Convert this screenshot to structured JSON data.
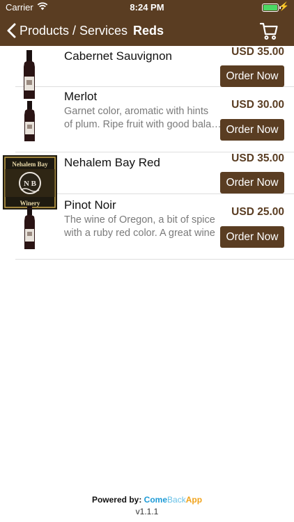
{
  "status_bar": {
    "carrier": "Carrier",
    "time": "8:24 PM"
  },
  "nav": {
    "back_label": "Products / Services",
    "title": "Reds"
  },
  "products": [
    {
      "name": "Cabernet Sauvignon",
      "desc_lines": [],
      "price": "USD 35.00",
      "order_label": "Order Now",
      "thumb": "wine-bottle"
    },
    {
      "name": "Merlot",
      "desc_lines": [
        "Garnet color, aromatic with hints",
        "of plum. Ripe fruit with good balance"
      ],
      "price": "USD 30.00",
      "order_label": "Order Now",
      "thumb": "wine-bottle"
    },
    {
      "name": "Nehalem Bay Red",
      "desc_lines": [],
      "price": "USD 35.00",
      "order_label": "Order Now",
      "thumb": "winery-logo",
      "thumb_text": [
        "Nehalem Bay",
        "N B",
        "Winery"
      ]
    },
    {
      "name": "Pinot Noir",
      "desc_lines": [
        "The wine of Oregon, a bit of spice",
        "with a ruby red color. A great wine"
      ],
      "price": "USD 25.00",
      "order_label": "Order Now",
      "thumb": "wine-bottle"
    }
  ],
  "footer": {
    "powered_by": "Powered by:",
    "brand_come": "Come",
    "brand_back": "Back",
    "brand_app": "App",
    "version": "v1.1.1"
  },
  "colors": {
    "accent": "#5a3d22",
    "battery": "#4cd964"
  }
}
